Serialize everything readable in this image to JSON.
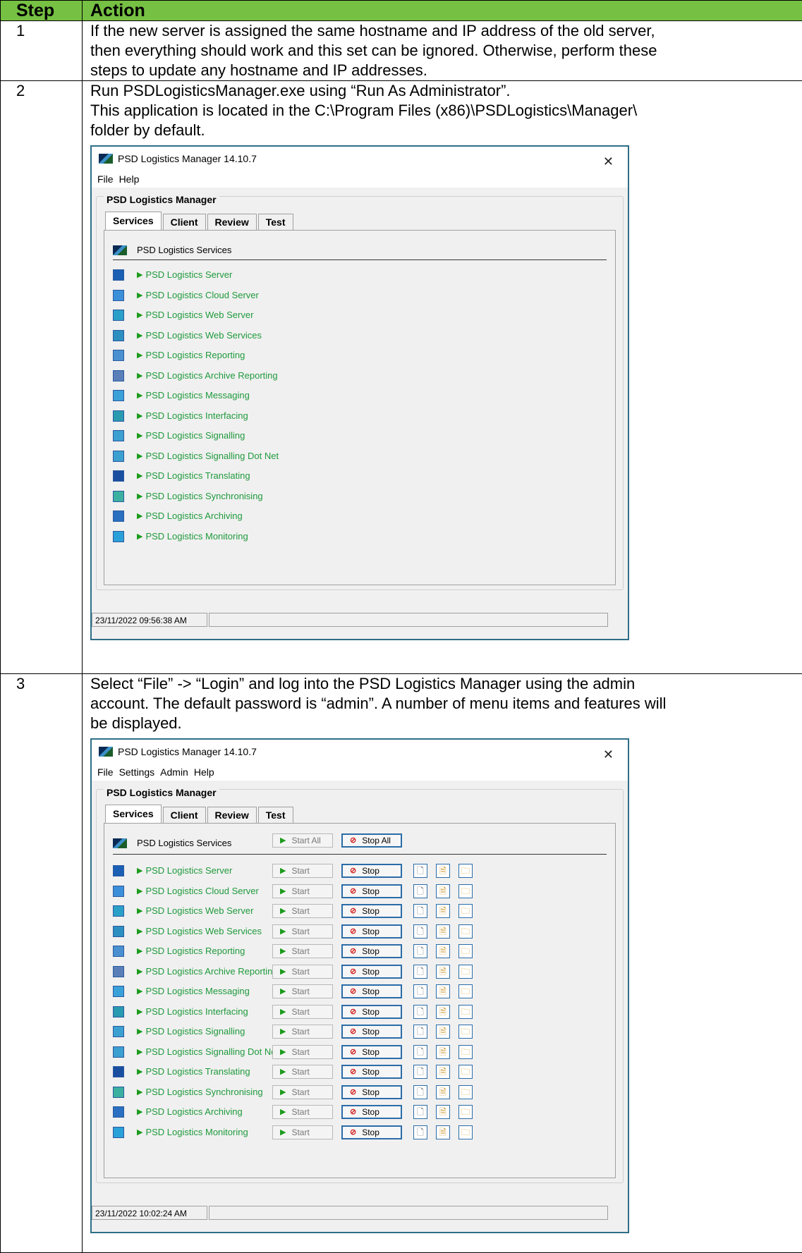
{
  "table": {
    "headers": [
      "Step",
      "Action"
    ],
    "colors": {
      "header_bg": "#76c043",
      "screenshot_border": "#2e6e87",
      "service_green": "#1f9a3c",
      "stop_red": "#d42020"
    }
  },
  "step1": {
    "num": "1",
    "lines": [
      "If the new server is assigned the same hostname and IP address of the old server,",
      "then everything should work and this set can be ignored. Otherwise, perform these",
      "steps to update any hostname and IP addresses."
    ]
  },
  "step2": {
    "num": "2",
    "lines": [
      "Run PSDLogisticsManager.exe using “Run As Administrator”.",
      "This application is located in the C:\\Program Files (x86)\\PSDLogistics\\Manager\\",
      "folder by default."
    ],
    "window": {
      "title": "PSD Logistics Manager 14.10.7",
      "menu": [
        "File",
        "Help"
      ],
      "group_title": "PSD Logistics Manager",
      "tabs": [
        "Services",
        "Client",
        "Review",
        "Test"
      ],
      "services_header": "PSD Logistics Services",
      "status_time": "23/11/2022 09:56:38 AM"
    }
  },
  "step3": {
    "num": "3",
    "lines": [
      "Select “File” -> “Login” and log into the PSD Logistics Manager using the admin",
      "account. The default password is “admin”. A number of menu items and features will",
      "be displayed."
    ],
    "window": {
      "title": "PSD Logistics Manager 14.10.7",
      "menu": [
        "File",
        "Settings",
        "Admin",
        "Help"
      ],
      "group_title": "PSD Logistics Manager",
      "tabs": [
        "Services",
        "Client",
        "Review",
        "Test"
      ],
      "services_header": "PSD Logistics Services",
      "start_all": "Start All",
      "stop_all": "Stop All",
      "start": "Start",
      "stop": "Stop",
      "status_time": "23/11/2022 10:02:24 AM"
    }
  },
  "services": [
    {
      "name": "PSD Logistics Server",
      "icon": "globe-icon",
      "color": "#1a5fb4"
    },
    {
      "name": "PSD Logistics Cloud Server",
      "icon": "cloud-icon",
      "color": "#3b8fd8"
    },
    {
      "name": "PSD Logistics Web Server",
      "icon": "web-icon",
      "color": "#2aa0c8"
    },
    {
      "name": "PSD Logistics Web Services",
      "icon": "web-services-icon",
      "color": "#2d8fbf"
    },
    {
      "name": "PSD Logistics Reporting",
      "icon": "report-icon",
      "color": "#4a90d0"
    },
    {
      "name": "PSD Logistics Archive Reporting",
      "icon": "archive-report-icon",
      "color": "#5a7fb8"
    },
    {
      "name": "PSD Logistics Messaging",
      "icon": "message-icon",
      "color": "#3aa0d8"
    },
    {
      "name": "PSD Logistics Interfacing",
      "icon": "interface-icon",
      "color": "#2a9ab0"
    },
    {
      "name": "PSD Logistics Signalling",
      "icon": "signal-icon",
      "color": "#3b9fd0"
    },
    {
      "name": "PSD Logistics Signalling Dot Net",
      "icon": "signal-dotnet-icon",
      "color": "#3b9fd0"
    },
    {
      "name": "PSD Logistics Translating",
      "icon": "translate-icon",
      "color": "#1a4fa0"
    },
    {
      "name": "PSD Logistics Synchronising",
      "icon": "sync-icon",
      "color": "#3bb0a0"
    },
    {
      "name": "PSD Logistics Archiving",
      "icon": "archive-icon",
      "color": "#2a6fc0"
    },
    {
      "name": "PSD Logistics Monitoring",
      "icon": "monitor-icon",
      "color": "#2aa0d8"
    }
  ]
}
